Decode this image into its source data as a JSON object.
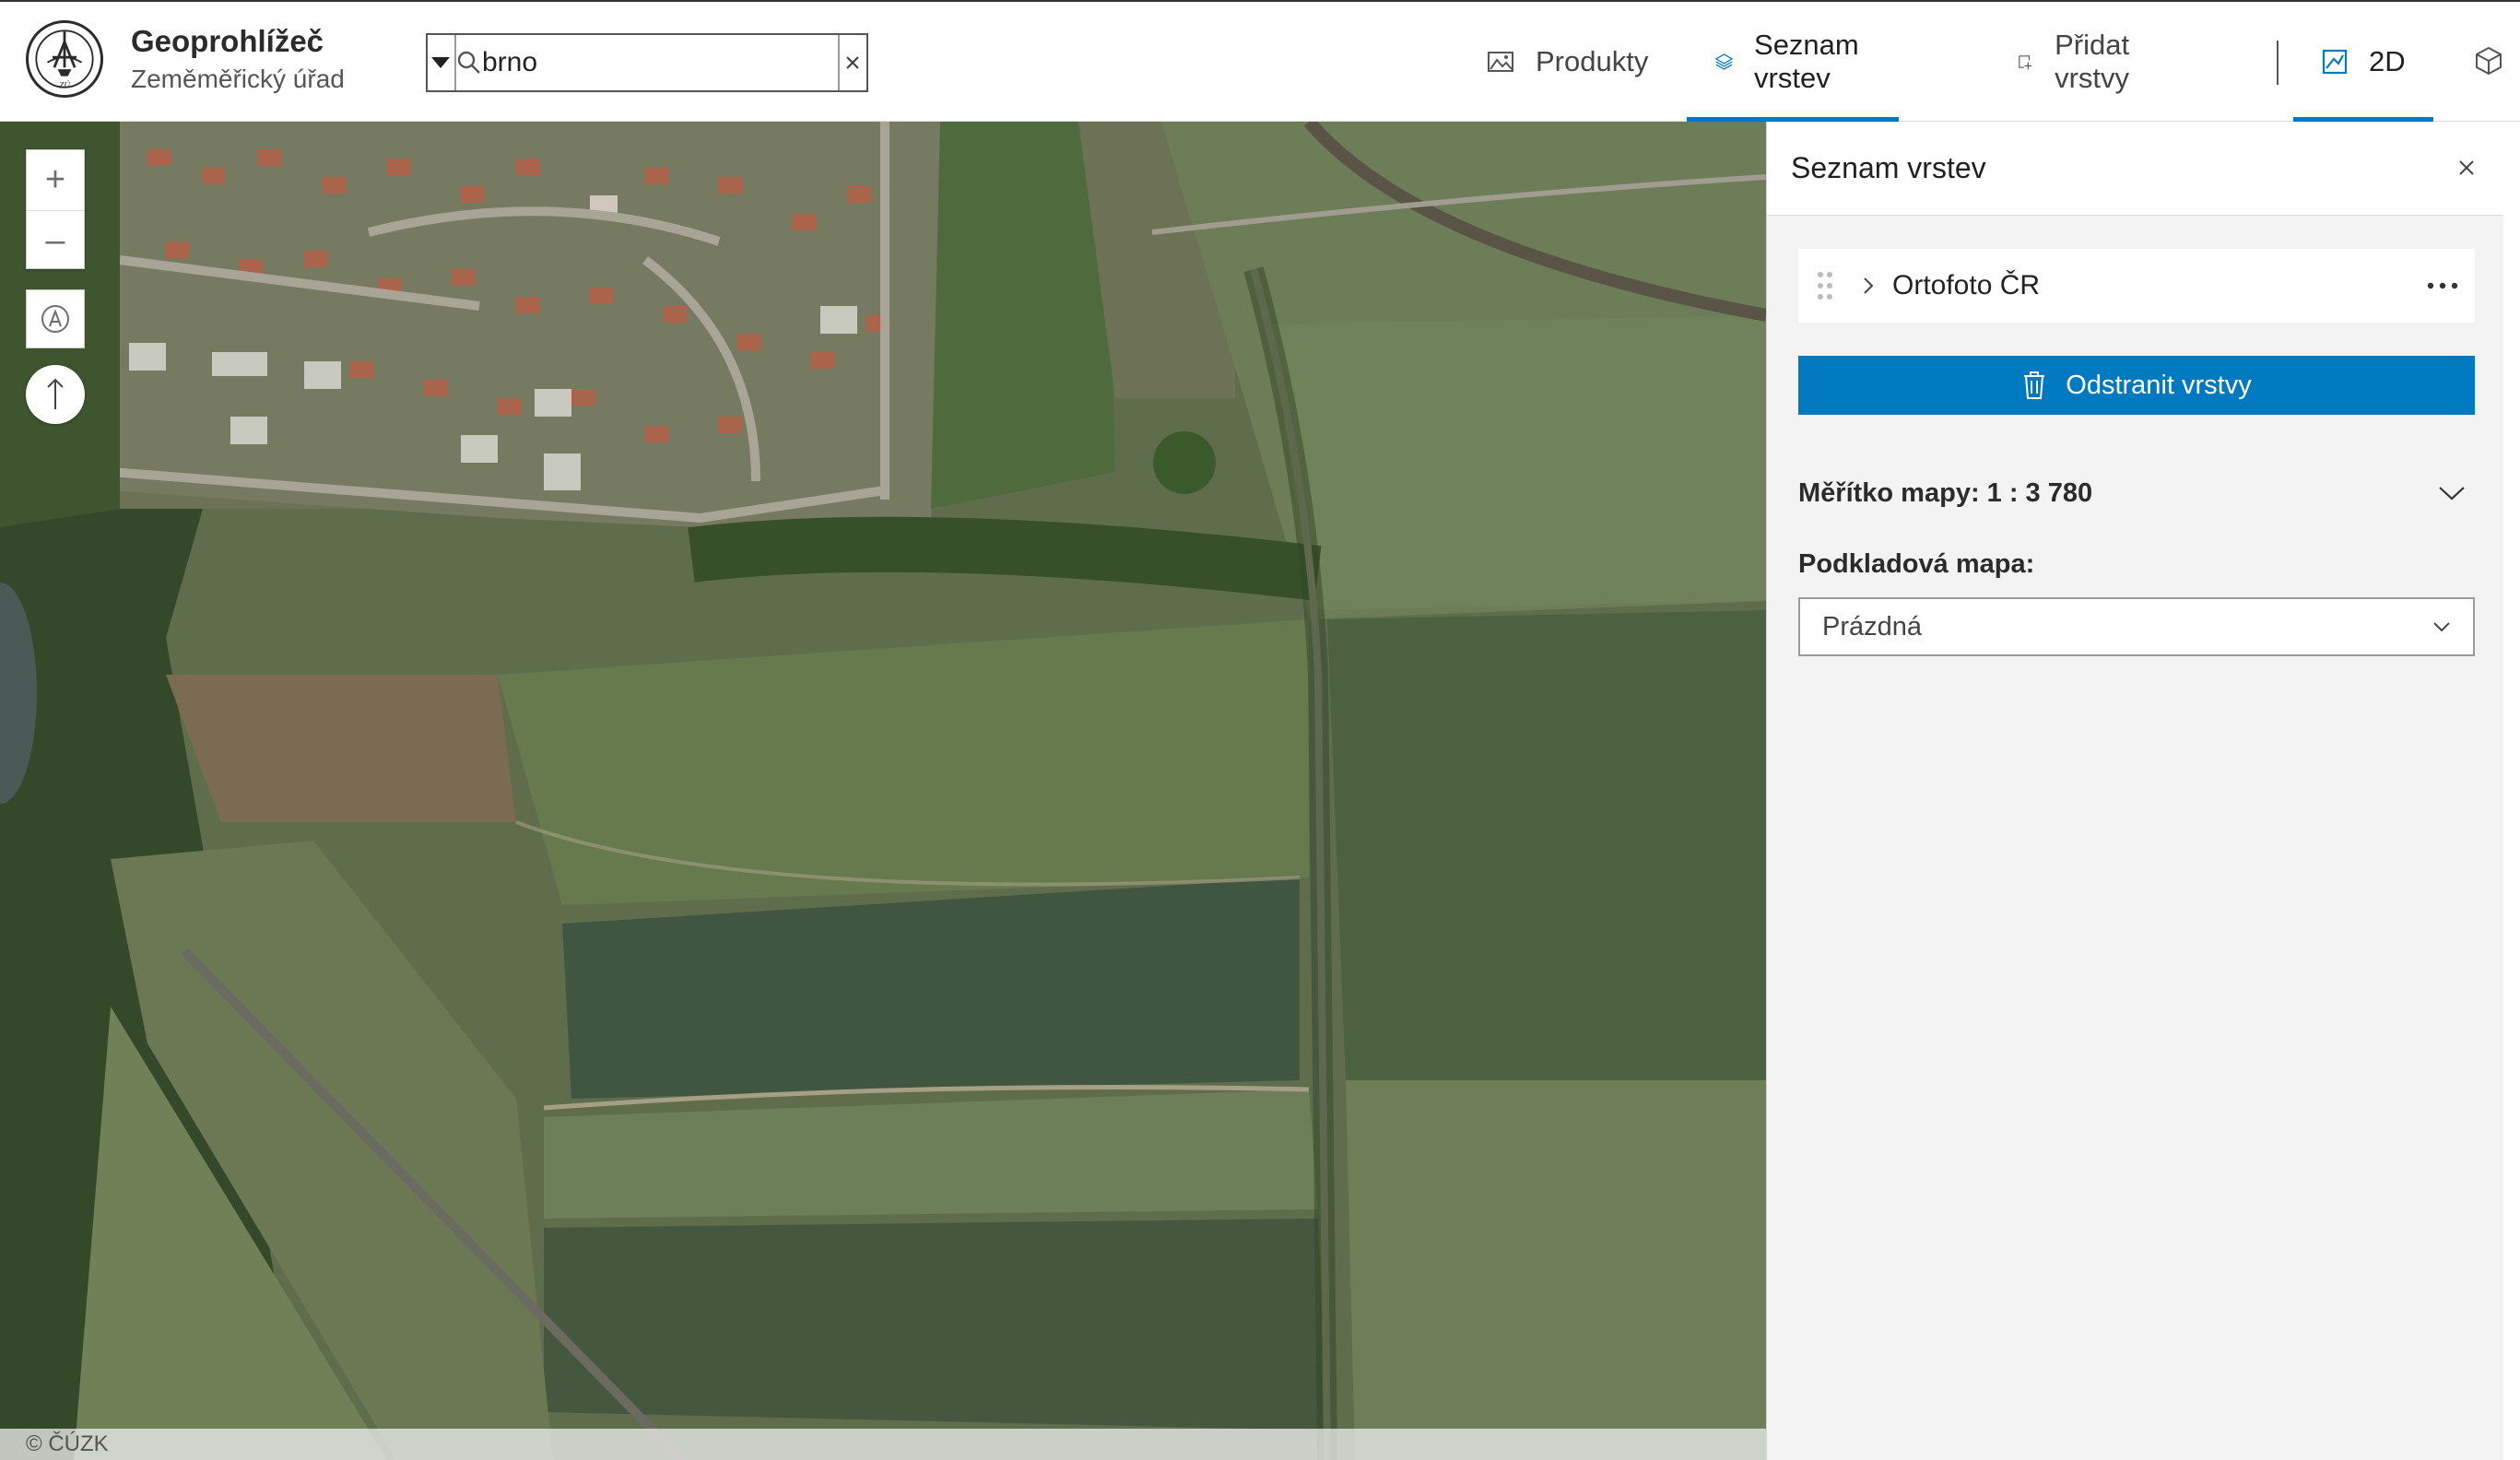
{
  "header": {
    "title": "Geoprohlížeč",
    "subtitle": "Zeměměřický úřad",
    "logo_text": "ZÚ"
  },
  "search": {
    "value": "brno",
    "placeholder": ""
  },
  "nav": {
    "items": [
      {
        "label": "Produkty",
        "icon": "image-icon",
        "active": false
      },
      {
        "label": "Seznam vrstev",
        "icon": "layers-icon",
        "active": true
      },
      {
        "label": "Přidat vrstvy",
        "icon": "add-layer-icon",
        "active": false
      }
    ],
    "view_2d_label": "2D",
    "view_2d_active": true
  },
  "map": {
    "attribution": "© ČÚZK",
    "zoom_in_label": "+",
    "zoom_out_label": "–"
  },
  "panel": {
    "title": "Seznam vrstev",
    "layers": [
      {
        "label": "Ortofoto ČR"
      }
    ],
    "remove_button_label": "Odstranit vrstvy",
    "scale_label": "Měřítko mapy: 1 : 3 780",
    "basemap_label": "Podkladová mapa:",
    "basemap_selected": "Prázdná"
  },
  "colors": {
    "accent": "#0079c1",
    "panel_bg": "#f3f3f3"
  }
}
